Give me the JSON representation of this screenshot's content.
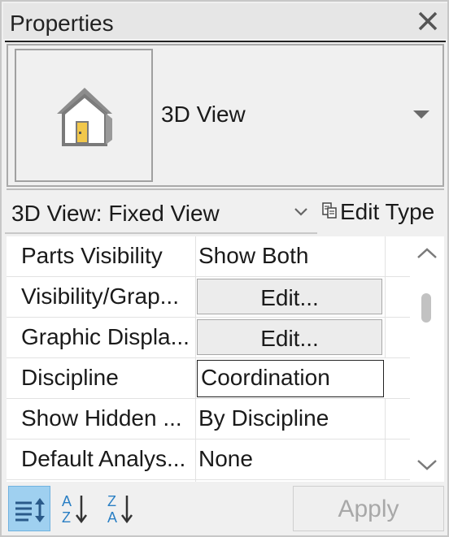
{
  "panel": {
    "title": "Properties"
  },
  "type_selector": {
    "name": "3D View",
    "icon": "house-icon"
  },
  "instance": {
    "value": "3D View: Fixed View",
    "edit_type_label": "Edit Type"
  },
  "properties": [
    {
      "name": "Parts Visibility",
      "value": "Show Both",
      "kind": "text"
    },
    {
      "name": "Visibility/Grap...",
      "value": "Edit...",
      "kind": "button"
    },
    {
      "name": "Graphic Displa...",
      "value": "Edit...",
      "kind": "button"
    },
    {
      "name": "Discipline",
      "value": "Coordination",
      "kind": "input"
    },
    {
      "name": "Show Hidden ...",
      "value": "By Discipline",
      "kind": "text"
    },
    {
      "name": "Default Analys...",
      "value": "None",
      "kind": "text"
    }
  ],
  "toolbar": {
    "sort_category_icon": "sort-by-category-icon",
    "sort_az_icon": "sort-ascending-icon",
    "sort_za_icon": "sort-descending-icon",
    "apply_label": "Apply"
  },
  "colors": {
    "active_toggle": "#9fd0f0",
    "house_roof": "#8c8c8c",
    "house_door": "#f2c84b"
  }
}
